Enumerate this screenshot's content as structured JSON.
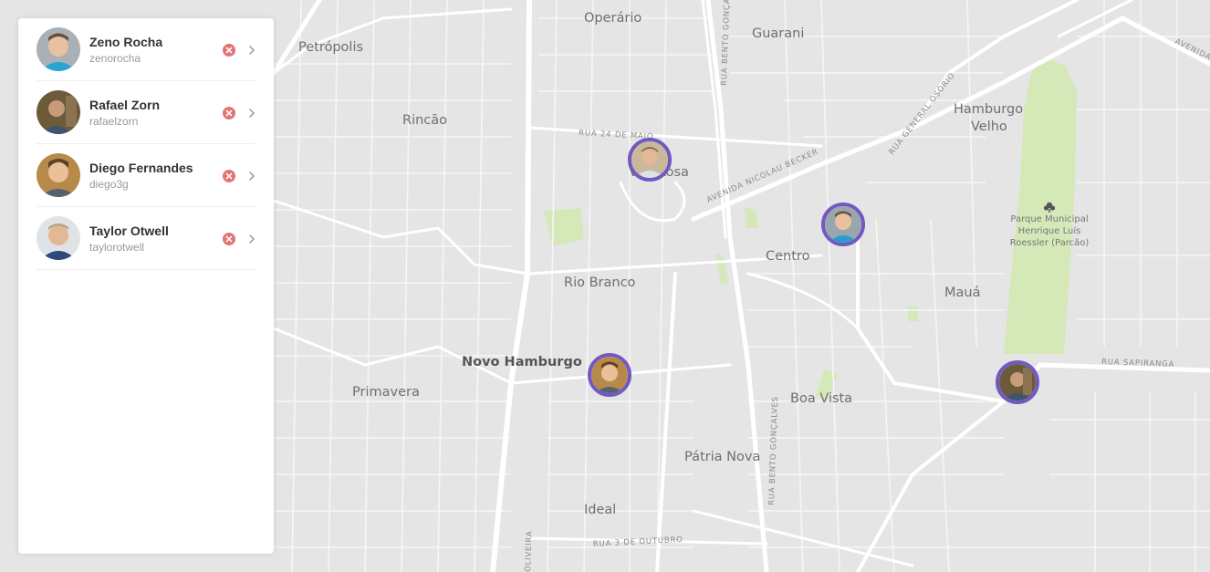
{
  "colors": {
    "accent": "#7159c1",
    "remove": "#e57373",
    "map_bg": "#e5e5e5",
    "road": "#ffffff",
    "park": "#d5e8b8"
  },
  "users": [
    {
      "name": "Zeno Rocha",
      "login": "zenorocha",
      "avatar_icon": "avatar-photo",
      "remove_icon": "close-circle-icon",
      "open_icon": "chevron-right-icon"
    },
    {
      "name": "Rafael Zorn",
      "login": "rafaelzorn",
      "avatar_icon": "avatar-photo",
      "remove_icon": "close-circle-icon",
      "open_icon": "chevron-right-icon"
    },
    {
      "name": "Diego Fernandes",
      "login": "diego3g",
      "avatar_icon": "avatar-photo",
      "remove_icon": "close-circle-icon",
      "open_icon": "chevron-right-icon"
    },
    {
      "name": "Taylor Otwell",
      "login": "taylorotwell",
      "avatar_icon": "avatar-photo",
      "remove_icon": "close-circle-icon",
      "open_icon": "chevron-right-icon"
    }
  ],
  "map": {
    "neighborhoods": {
      "operario": "Operário",
      "guarani": "Guarani",
      "petropolis": "Petrópolis",
      "rincao": "Rincão",
      "hamburgo_velho": [
        "Hamburgo",
        "Velho"
      ],
      "vila_rosa": "Vila Rosa",
      "centro": "Centro",
      "rio_branco": "Rio Branco",
      "maua": "Mauá",
      "novo_hamburgo": "Novo Hamburgo",
      "primavera": "Primavera",
      "boa_vista": "Boa Vista",
      "patria_nova": "Pátria Nova",
      "ideal": "Ideal"
    },
    "streets": {
      "rua_24_de_maio": "RUA 24 DE MAIO",
      "av_nicolau_becker": "AVENIDA NICOLAU BECKER",
      "rua_general_osorio": "RUA GENERAL OSÓRIO",
      "rua_bento_goncalves_top": "RUA BENTO GONÇALVES",
      "rua_bento_goncalves_bottom": "RUA BENTO GONÇALVES",
      "rua_sapiranga": "RUA SAPIRANGA",
      "rua_3_de_outubro": "RUA 3 DE OUTUBRO",
      "avenida_edge": "AVENIDA",
      "oliveira_edge": "OLIVEIRA"
    },
    "park": {
      "icon": "tree-icon",
      "lines": [
        "Parque Municipal",
        "Henrique Luís",
        "Roessler (Parcão)"
      ]
    },
    "markers_icon": "user-map-marker"
  }
}
